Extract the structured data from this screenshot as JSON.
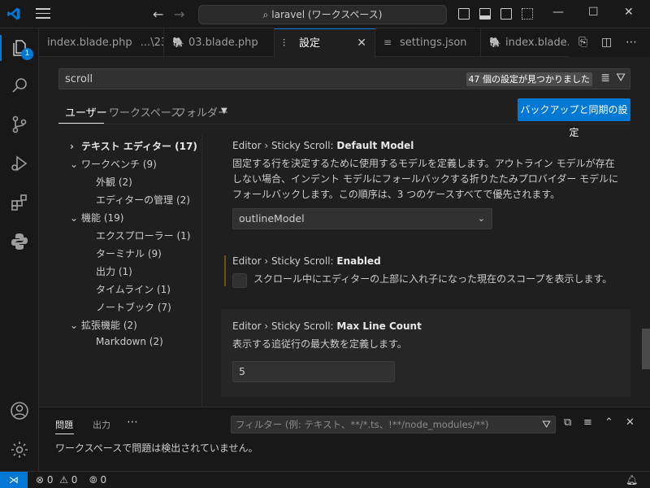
{
  "titlebar": {
    "search_text": "laravel (ワークスペース)"
  },
  "activity": {
    "explorer_badge": "1"
  },
  "tabs": [
    {
      "label": "index.blade.php",
      "suffix": "...\\23"
    },
    {
      "label": "03.blade.php"
    },
    {
      "label": "設定"
    },
    {
      "label": "settings.json"
    },
    {
      "label": "index.blade.php"
    }
  ],
  "settings": {
    "search_value": "scroll",
    "result_count": "47 個の設定が見つかりました",
    "scopes": [
      "ユーザー",
      "ワークスペース",
      "フォルダー"
    ],
    "backup_button": "バックアップと同期の設定",
    "toc": [
      {
        "label": "テキスト エディター (17)",
        "level": 0,
        "expanded": false,
        "bold": true
      },
      {
        "label": "ワークベンチ (9)",
        "level": 0,
        "expanded": true
      },
      {
        "label": "外観 (2)",
        "level": 1
      },
      {
        "label": "エディターの管理 (2)",
        "level": 1
      },
      {
        "label": "機能 (19)",
        "level": 0,
        "expanded": true
      },
      {
        "label": "エクスプローラー (1)",
        "level": 1
      },
      {
        "label": "ターミナル (9)",
        "level": 1
      },
      {
        "label": "出力 (1)",
        "level": 1
      },
      {
        "label": "タイムライン (1)",
        "level": 1
      },
      {
        "label": "ノートブック (7)",
        "level": 1
      },
      {
        "label": "拡張機能 (2)",
        "level": 0,
        "expanded": true
      },
      {
        "label": "Markdown (2)",
        "level": 1
      }
    ],
    "items": [
      {
        "prefix": "Editor › Sticky Scroll: ",
        "name": "Default Model",
        "desc": "固定する行を決定するために使用するモデルを定義します。アウトライン モデルが存在しない場合、インデント モデルにフォールバックする折りたたみプロバイダー モデルにフォールバックします。この順序は、3 つのケースすべてで優先されます。",
        "value": "outlineModel"
      },
      {
        "prefix": "Editor › Sticky Scroll: ",
        "name": "Enabled",
        "desc": "スクロール中にエディターの上部に入れ子になった現在のスコープを表示します。"
      },
      {
        "prefix": "Editor › Sticky Scroll: ",
        "name": "Max Line Count",
        "desc": "表示する追従行の最大数を定義します。",
        "value": "5"
      }
    ]
  },
  "panel": {
    "tabs": [
      "問題",
      "出力"
    ],
    "filter_placeholder": "フィルター (例: テキスト、**/*.ts、!**/node_modules/**)",
    "message": "ワークスペースで問題は検出されていません。"
  },
  "status": {
    "errors": "0",
    "warnings": "0",
    "ports": "0"
  },
  "colors": {
    "accent": "#0078d4",
    "background": "#1f1f1f",
    "chrome": "#181818"
  }
}
